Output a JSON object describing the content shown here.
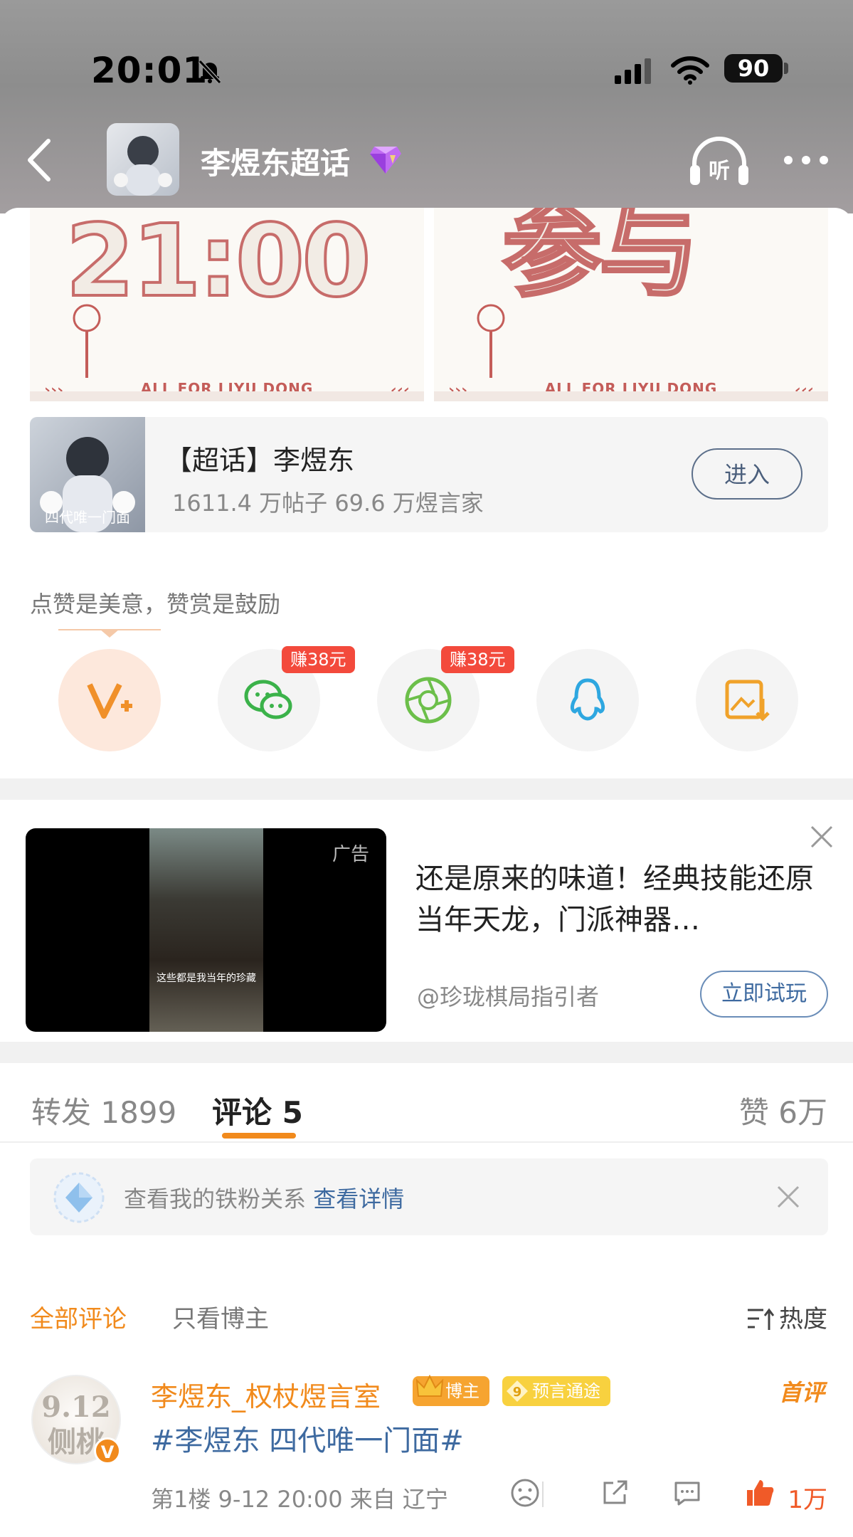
{
  "status_bar": {
    "time": "20:01",
    "battery": "90"
  },
  "nav": {
    "title": "李煜东超话",
    "listen_label": "听"
  },
  "banner": {
    "left_text": "21:00",
    "right_text": "参与",
    "left_footer": "ALL FOR LIYU DONG",
    "right_footer": "ALL FOR LIYU DONG"
  },
  "topic_card": {
    "title": "【超话】李煜东",
    "stats": "1611.4 万帖子  69.6 万煜言家",
    "thumb_caption": "四代唯一门面",
    "enter_label": "进入"
  },
  "reward": {
    "text": "点赞是美意，赞赏是鼓励"
  },
  "share": {
    "wechat_earn": "赚38元",
    "moments_earn": "赚38元"
  },
  "ad": {
    "label": "广告",
    "video_caption": "这些都是我当年的珍藏",
    "text": "还是原来的味道！经典技能还原当年天龙，门派神器…",
    "author": "@珍珑棋局指引者",
    "cta": "立即试玩"
  },
  "tabs": {
    "repost": "转发 1899",
    "comment": "评论 5",
    "like": "赞 6万"
  },
  "iron_fan": {
    "text": "查看我的铁粉关系",
    "link": "查看详情"
  },
  "filters": {
    "all": "全部评论",
    "owner_only": "只看博主",
    "sort": "热度"
  },
  "comment": {
    "avatar_line1": "9.12",
    "avatar_line2": "侧桃",
    "name": "李煜东_权杖煜言室",
    "badge_owner": "博主",
    "badge_prophecy": "预言通途",
    "first": "首评",
    "text": "#李煜东 四代唯一门面#",
    "meta": "第1楼  9-12 20:00  来自 辽宁",
    "likes": "1万"
  },
  "colors": {
    "accent": "#f18a1c",
    "link": "#3e6aa0",
    "earn": "#f34a3c"
  }
}
